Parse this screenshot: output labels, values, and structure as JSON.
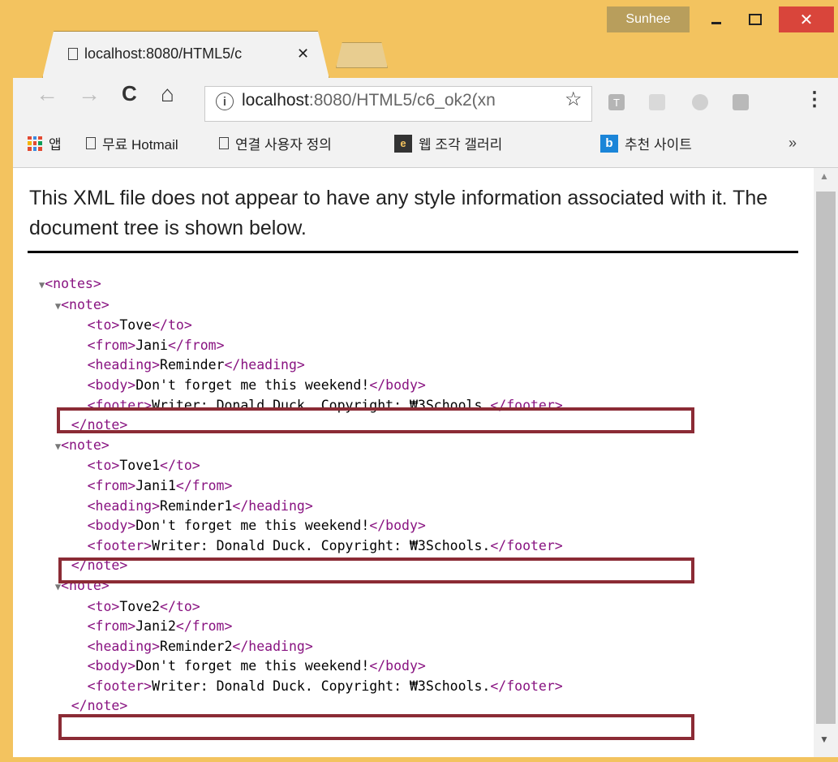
{
  "window": {
    "user": "Sunhee",
    "min": "–",
    "close": "✕"
  },
  "tab": {
    "title": "localhost:8080/HTML5/c",
    "close": "✕"
  },
  "toolbar": {
    "back": "←",
    "forward": "→",
    "reload": "C",
    "home": "⌂",
    "info": "i",
    "url_host": "localhost",
    "url_path": ":8080/HTML5/c6_ok2(xn",
    "star": "☆",
    "ext_t": "T",
    "menu": "⋮"
  },
  "bookmarks": {
    "apps": "앱",
    "hotmail": "무료 Hotmail",
    "custom": "연결 사용자 정의",
    "ie_letter": "e",
    "gallery": "웹 조각 갤러리",
    "bing_letter": "b",
    "recommended": "추천 사이트",
    "more": "»"
  },
  "notice": "This XML file does not appear to have any style information associated with it. The document tree is shown below.",
  "xml": {
    "root_open": "<notes>",
    "notes": [
      {
        "to": "Tove",
        "from": "Jani",
        "heading": "Reminder",
        "body": "Don't forget me this weekend!",
        "footer": "Writer: Donald Duck. Copyright: ₩3Schools."
      },
      {
        "to": "Tove1",
        "from": "Jani1",
        "heading": "Reminder1",
        "body": "Don't forget me this weekend!",
        "footer": "Writer: Donald Duck. Copyright: ₩3Schools."
      },
      {
        "to": "Tove2",
        "from": "Jani2",
        "heading": "Reminder2",
        "body": "Don't forget me this weekend!",
        "footer": "Writer: Donald Duck. Copyright: ₩3Schools."
      }
    ],
    "tags": {
      "note_open": "<note>",
      "note_close": "</note>",
      "to_open": "<to>",
      "to_close": "</to>",
      "from_open": "<from>",
      "from_close": "</from>",
      "heading_open": "<heading>",
      "heading_close": "</heading>",
      "body_open": "<body>",
      "body_close": "</body>",
      "footer_open": "<footer>",
      "footer_close": "</footer>"
    }
  },
  "colors": {
    "frame": "#f3c35f",
    "tag": "#881280",
    "highlight": "#8b2b35",
    "close_btn": "#d9453b"
  }
}
